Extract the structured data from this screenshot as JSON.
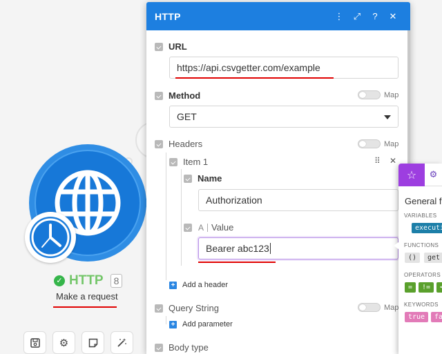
{
  "module": {
    "name": "HTTP",
    "count": "8",
    "subtitle": "Make a request"
  },
  "toolbar": {
    "save_icon": "save-icon",
    "settings_icon": "gear-icon",
    "notes_icon": "note-icon",
    "magic_icon": "magic-wand-icon"
  },
  "panel": {
    "title": "HTTP",
    "url": {
      "label": "URL",
      "value": "https://api.csvgetter.com/example"
    },
    "method": {
      "label": "Method",
      "value": "GET",
      "map_label": "Map"
    },
    "headers": {
      "label": "Headers",
      "map_label": "Map",
      "item_label": "Item 1",
      "name_label": "Name",
      "name_value": "Authorization",
      "value_type": "A",
      "value_label": "Value",
      "value_value": "Bearer abc123",
      "add_label": "Add a header"
    },
    "query": {
      "label": "Query String",
      "map_label": "Map",
      "add_label": "Add parameter"
    },
    "body": {
      "label": "Body type"
    }
  },
  "vars_panel": {
    "title": "General f",
    "sections": {
      "variables": "VARIABLES",
      "functions": "FUNCTIONS",
      "operators": "OPERATORS",
      "keywords": "KEYWORDS"
    },
    "variables_pill": "executi",
    "functions_pills": [
      "()",
      "get"
    ],
    "operators_pills": [
      "=",
      "!=",
      "<"
    ],
    "keywords_pills": [
      "true",
      "fa"
    ]
  },
  "colors": {
    "header_blue": "#1d7fe0",
    "module_blue": "#1778d8",
    "success_green": "#35b54a",
    "vars_purple": "#9d3ee0",
    "underline_red": "#e00000"
  }
}
